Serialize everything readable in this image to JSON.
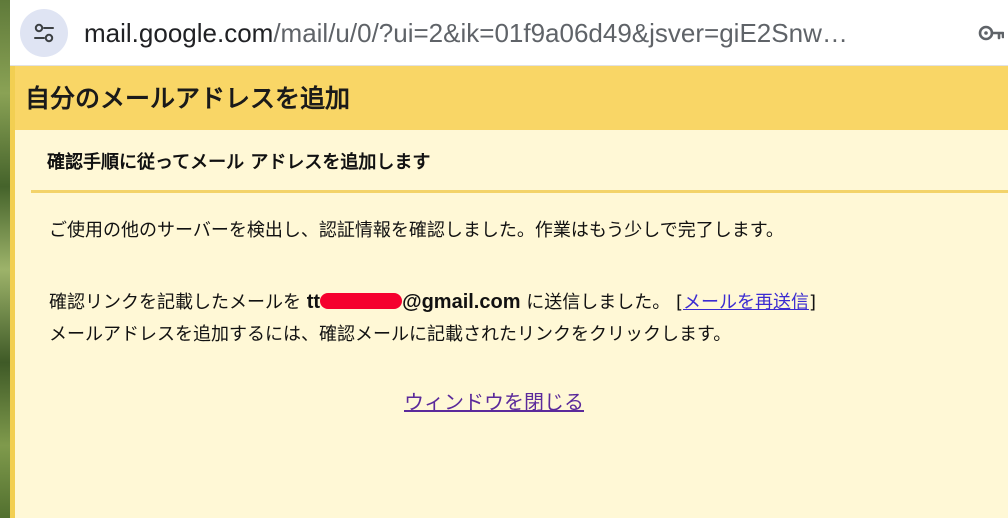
{
  "browser": {
    "url_host": "mail.google.com",
    "url_rest": "/mail/u/0/?ui=2&ik=01f9a06d49&jsver=giE2Snw…",
    "site_info_icon": "tune-icon",
    "key_icon": "key-icon"
  },
  "dialog": {
    "title": "自分のメールアドレスを追加",
    "subhead": "確認手順に従ってメール アドレスを追加します",
    "para1": "ご使用の他のサーバーを検出し、認証情報を確認しました。作業はもう少しで完了します。",
    "para2_prefix": "確認リンクを記載したメールを",
    "email_visible_start": "tt",
    "email_visible_end": "@gmail.com",
    "para2_suffix": "に送信しました。",
    "resend_open": "[",
    "resend_label": "メールを再送信",
    "resend_close": "]",
    "para3": "メールアドレスを追加するには、確認メールに記載されたリンクをクリックします。",
    "close_label": "ウィンドウを閉じる"
  },
  "colors": {
    "titlebar": "#f9d666",
    "background": "#fff8d6",
    "link": "#3b2bd1",
    "visited_link": "#5b2a9b",
    "redaction": "#f5002e"
  }
}
